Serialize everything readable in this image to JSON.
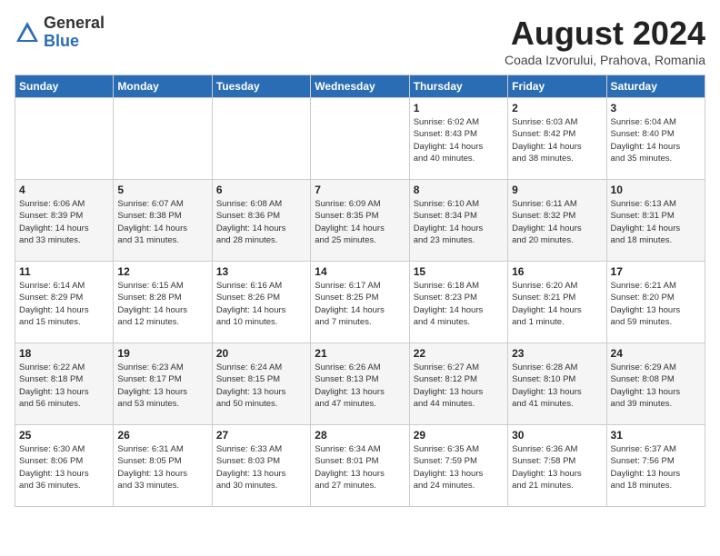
{
  "header": {
    "logo_general": "General",
    "logo_blue": "Blue",
    "month_year": "August 2024",
    "location": "Coada Izvorului, Prahova, Romania"
  },
  "days_of_week": [
    "Sunday",
    "Monday",
    "Tuesday",
    "Wednesday",
    "Thursday",
    "Friday",
    "Saturday"
  ],
  "weeks": [
    [
      {
        "day": "",
        "info": ""
      },
      {
        "day": "",
        "info": ""
      },
      {
        "day": "",
        "info": ""
      },
      {
        "day": "",
        "info": ""
      },
      {
        "day": "1",
        "info": "Sunrise: 6:02 AM\nSunset: 8:43 PM\nDaylight: 14 hours\nand 40 minutes."
      },
      {
        "day": "2",
        "info": "Sunrise: 6:03 AM\nSunset: 8:42 PM\nDaylight: 14 hours\nand 38 minutes."
      },
      {
        "day": "3",
        "info": "Sunrise: 6:04 AM\nSunset: 8:40 PM\nDaylight: 14 hours\nand 35 minutes."
      }
    ],
    [
      {
        "day": "4",
        "info": "Sunrise: 6:06 AM\nSunset: 8:39 PM\nDaylight: 14 hours\nand 33 minutes."
      },
      {
        "day": "5",
        "info": "Sunrise: 6:07 AM\nSunset: 8:38 PM\nDaylight: 14 hours\nand 31 minutes."
      },
      {
        "day": "6",
        "info": "Sunrise: 6:08 AM\nSunset: 8:36 PM\nDaylight: 14 hours\nand 28 minutes."
      },
      {
        "day": "7",
        "info": "Sunrise: 6:09 AM\nSunset: 8:35 PM\nDaylight: 14 hours\nand 25 minutes."
      },
      {
        "day": "8",
        "info": "Sunrise: 6:10 AM\nSunset: 8:34 PM\nDaylight: 14 hours\nand 23 minutes."
      },
      {
        "day": "9",
        "info": "Sunrise: 6:11 AM\nSunset: 8:32 PM\nDaylight: 14 hours\nand 20 minutes."
      },
      {
        "day": "10",
        "info": "Sunrise: 6:13 AM\nSunset: 8:31 PM\nDaylight: 14 hours\nand 18 minutes."
      }
    ],
    [
      {
        "day": "11",
        "info": "Sunrise: 6:14 AM\nSunset: 8:29 PM\nDaylight: 14 hours\nand 15 minutes."
      },
      {
        "day": "12",
        "info": "Sunrise: 6:15 AM\nSunset: 8:28 PM\nDaylight: 14 hours\nand 12 minutes."
      },
      {
        "day": "13",
        "info": "Sunrise: 6:16 AM\nSunset: 8:26 PM\nDaylight: 14 hours\nand 10 minutes."
      },
      {
        "day": "14",
        "info": "Sunrise: 6:17 AM\nSunset: 8:25 PM\nDaylight: 14 hours\nand 7 minutes."
      },
      {
        "day": "15",
        "info": "Sunrise: 6:18 AM\nSunset: 8:23 PM\nDaylight: 14 hours\nand 4 minutes."
      },
      {
        "day": "16",
        "info": "Sunrise: 6:20 AM\nSunset: 8:21 PM\nDaylight: 14 hours\nand 1 minute."
      },
      {
        "day": "17",
        "info": "Sunrise: 6:21 AM\nSunset: 8:20 PM\nDaylight: 13 hours\nand 59 minutes."
      }
    ],
    [
      {
        "day": "18",
        "info": "Sunrise: 6:22 AM\nSunset: 8:18 PM\nDaylight: 13 hours\nand 56 minutes."
      },
      {
        "day": "19",
        "info": "Sunrise: 6:23 AM\nSunset: 8:17 PM\nDaylight: 13 hours\nand 53 minutes."
      },
      {
        "day": "20",
        "info": "Sunrise: 6:24 AM\nSunset: 8:15 PM\nDaylight: 13 hours\nand 50 minutes."
      },
      {
        "day": "21",
        "info": "Sunrise: 6:26 AM\nSunset: 8:13 PM\nDaylight: 13 hours\nand 47 minutes."
      },
      {
        "day": "22",
        "info": "Sunrise: 6:27 AM\nSunset: 8:12 PM\nDaylight: 13 hours\nand 44 minutes."
      },
      {
        "day": "23",
        "info": "Sunrise: 6:28 AM\nSunset: 8:10 PM\nDaylight: 13 hours\nand 41 minutes."
      },
      {
        "day": "24",
        "info": "Sunrise: 6:29 AM\nSunset: 8:08 PM\nDaylight: 13 hours\nand 39 minutes."
      }
    ],
    [
      {
        "day": "25",
        "info": "Sunrise: 6:30 AM\nSunset: 8:06 PM\nDaylight: 13 hours\nand 36 minutes."
      },
      {
        "day": "26",
        "info": "Sunrise: 6:31 AM\nSunset: 8:05 PM\nDaylight: 13 hours\nand 33 minutes."
      },
      {
        "day": "27",
        "info": "Sunrise: 6:33 AM\nSunset: 8:03 PM\nDaylight: 13 hours\nand 30 minutes."
      },
      {
        "day": "28",
        "info": "Sunrise: 6:34 AM\nSunset: 8:01 PM\nDaylight: 13 hours\nand 27 minutes."
      },
      {
        "day": "29",
        "info": "Sunrise: 6:35 AM\nSunset: 7:59 PM\nDaylight: 13 hours\nand 24 minutes."
      },
      {
        "day": "30",
        "info": "Sunrise: 6:36 AM\nSunset: 7:58 PM\nDaylight: 13 hours\nand 21 minutes."
      },
      {
        "day": "31",
        "info": "Sunrise: 6:37 AM\nSunset: 7:56 PM\nDaylight: 13 hours\nand 18 minutes."
      }
    ]
  ]
}
